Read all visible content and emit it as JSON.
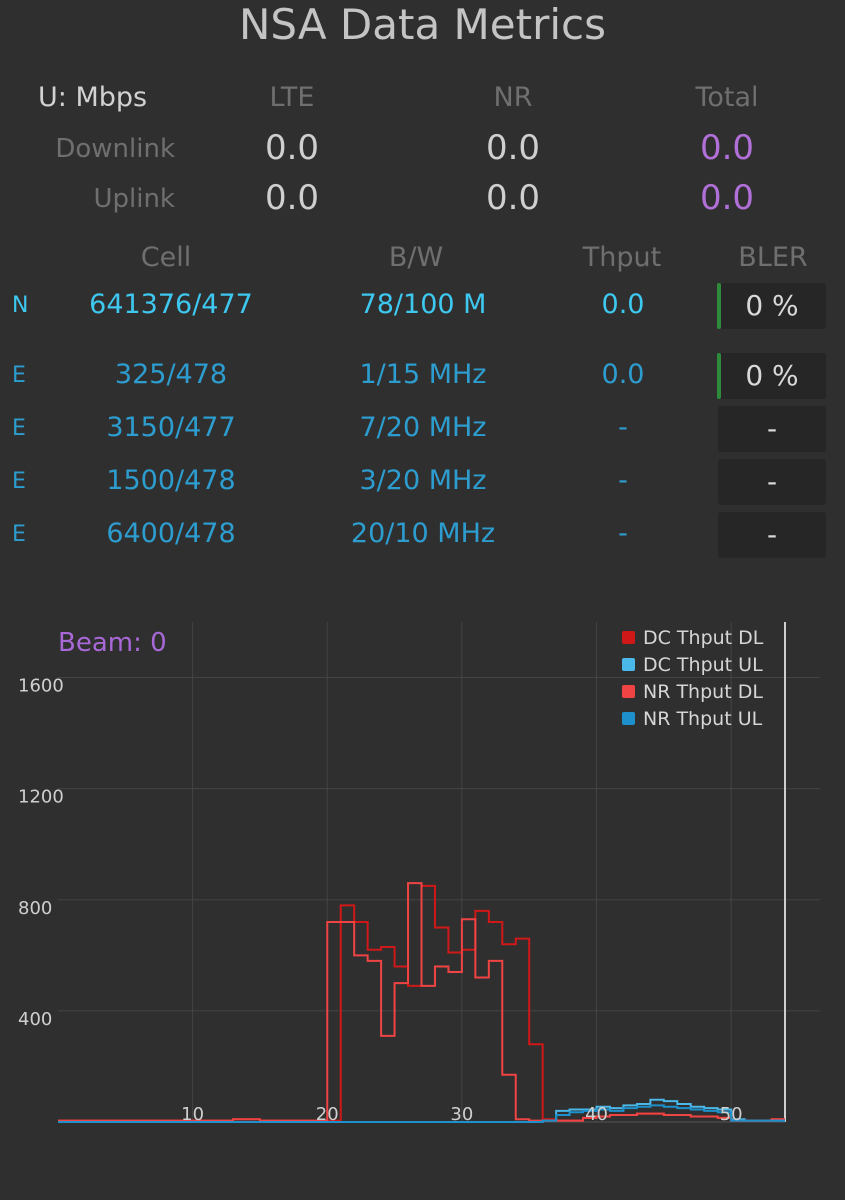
{
  "title": "NSA Data Metrics",
  "summary": {
    "unit_label": "U: Mbps",
    "columns": [
      "LTE",
      "NR",
      "Total"
    ],
    "rows": [
      {
        "label": "Downlink",
        "lte": "0.0",
        "nr": "0.0",
        "total": "0.0"
      },
      {
        "label": "Uplink",
        "lte": "0.0",
        "nr": "0.0",
        "total": "0.0"
      }
    ]
  },
  "cells": {
    "headers": [
      "Cell",
      "B/W",
      "Thput",
      "BLER"
    ],
    "rows": [
      {
        "type": "N",
        "cell": "641376/477",
        "bw": "78/100 M",
        "thput": "0.0",
        "bler": "0 %",
        "bler_active": true
      },
      {
        "type": "E",
        "cell": "325/478",
        "bw": "1/15 MHz",
        "thput": "0.0",
        "bler": "0 %",
        "bler_active": true
      },
      {
        "type": "E",
        "cell": "3150/477",
        "bw": "7/20 MHz",
        "thput": "-",
        "bler": "-",
        "bler_active": false
      },
      {
        "type": "E",
        "cell": "1500/478",
        "bw": "3/20 MHz",
        "thput": "-",
        "bler": "-",
        "bler_active": false
      },
      {
        "type": "E",
        "cell": "6400/478",
        "bw": "20/10 MHz",
        "thput": "-",
        "bler": "-",
        "bler_active": false
      }
    ]
  },
  "beam_label": "Beam: 0",
  "colors": {
    "nr_cell": "#3ec8f0",
    "lte_cell": "#2d9dd0",
    "total": "#b070d8",
    "bler_indicator": "#2e8b3a"
  },
  "chart_data": {
    "type": "line",
    "step": true,
    "xlim": [
      0,
      54
    ],
    "ylim": [
      0,
      1800
    ],
    "xticks": [
      10,
      20,
      30,
      40,
      50
    ],
    "yticks": [
      400,
      800,
      1200,
      1600
    ],
    "grid": true,
    "legend_position": "top-right",
    "series": [
      {
        "name": "DC Thput DL",
        "color": "#d01818",
        "x": [
          0,
          4,
          9,
          13,
          15,
          17,
          18,
          19,
          20,
          21,
          22,
          23,
          24,
          25,
          26,
          27,
          28,
          29,
          30,
          31,
          32,
          33,
          34,
          35,
          36,
          37,
          38,
          39,
          40,
          41,
          42,
          43,
          44,
          45,
          46,
          47,
          48,
          49,
          50,
          51,
          52,
          53,
          54
        ],
        "y": [
          5,
          5,
          5,
          10,
          5,
          5,
          5,
          5,
          5,
          780,
          720,
          620,
          630,
          560,
          490,
          850,
          700,
          610,
          620,
          760,
          720,
          640,
          660,
          280,
          10,
          5,
          5,
          15,
          20,
          25,
          25,
          30,
          30,
          25,
          25,
          20,
          20,
          15,
          5,
          5,
          5,
          10,
          10
        ]
      },
      {
        "name": "DC Thput UL",
        "color": "#4ab8e8",
        "x": [
          0,
          20,
          33,
          34,
          35,
          36,
          37,
          38,
          39,
          40,
          41,
          42,
          43,
          44,
          45,
          46,
          47,
          48,
          49,
          50,
          51,
          52,
          53,
          54
        ],
        "y": [
          0,
          0,
          0,
          0,
          0,
          5,
          40,
          45,
          45,
          55,
          50,
          60,
          65,
          80,
          75,
          65,
          55,
          50,
          45,
          10,
          5,
          5,
          5,
          5
        ]
      },
      {
        "name": "NR Thput DL",
        "color": "#f04444",
        "x": [
          0,
          4,
          9,
          13,
          15,
          17,
          18,
          19,
          20,
          21,
          22,
          23,
          24,
          25,
          26,
          27,
          28,
          29,
          30,
          31,
          32,
          33,
          34,
          35,
          36,
          37,
          38,
          39,
          40,
          41,
          42,
          43,
          44,
          45,
          46,
          47,
          48,
          49,
          50,
          51,
          52,
          53,
          54
        ],
        "y": [
          5,
          5,
          5,
          10,
          5,
          5,
          5,
          5,
          720,
          720,
          600,
          580,
          310,
          500,
          860,
          490,
          560,
          540,
          730,
          520,
          580,
          170,
          10,
          5,
          5,
          5,
          5,
          15,
          20,
          25,
          25,
          30,
          30,
          25,
          25,
          20,
          20,
          15,
          5,
          5,
          5,
          10,
          10
        ]
      },
      {
        "name": "NR Thput UL",
        "color": "#1e90cc",
        "x": [
          0,
          20,
          33,
          34,
          35,
          36,
          37,
          38,
          39,
          40,
          41,
          42,
          43,
          44,
          45,
          46,
          47,
          48,
          49,
          50,
          51,
          52,
          53,
          54
        ],
        "y": [
          0,
          0,
          0,
          0,
          0,
          5,
          25,
          35,
          40,
          45,
          40,
          50,
          55,
          60,
          55,
          50,
          45,
          40,
          35,
          5,
          5,
          5,
          5,
          5
        ]
      }
    ]
  }
}
